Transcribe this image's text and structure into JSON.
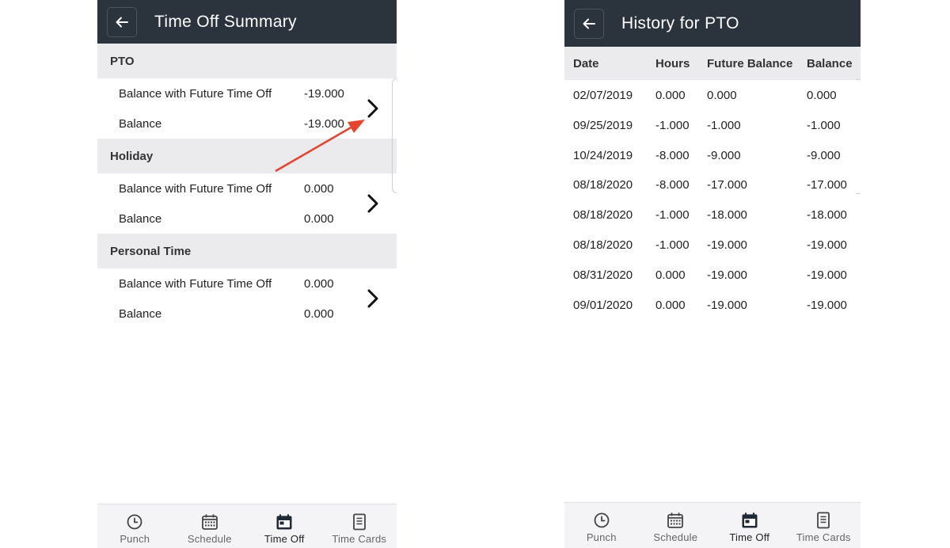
{
  "summary": {
    "title": "Time Off Summary",
    "sections": [
      {
        "name": "PTO",
        "rows": [
          {
            "label": "Balance with Future Time Off",
            "value": "-19.000"
          },
          {
            "label": "Balance",
            "value": "-19.000"
          }
        ]
      },
      {
        "name": "Holiday",
        "rows": [
          {
            "label": "Balance with Future Time Off",
            "value": "0.000"
          },
          {
            "label": "Balance",
            "value": "0.000"
          }
        ]
      },
      {
        "name": "Personal Time",
        "rows": [
          {
            "label": "Balance with Future Time Off",
            "value": "0.000"
          },
          {
            "label": "Balance",
            "value": "0.000"
          }
        ]
      }
    ]
  },
  "history": {
    "title": "History for PTO",
    "columns": [
      "Date",
      "Hours",
      "Future Balance",
      "Balance"
    ],
    "rows": [
      [
        "02/07/2019",
        "0.000",
        "0.000",
        "0.000"
      ],
      [
        "09/25/2019",
        "-1.000",
        "-1.000",
        "-1.000"
      ],
      [
        "10/24/2019",
        "-8.000",
        "-9.000",
        "-9.000"
      ],
      [
        "08/18/2020",
        "-8.000",
        "-17.000",
        "-17.000"
      ],
      [
        "08/18/2020",
        "-1.000",
        "-18.000",
        "-18.000"
      ],
      [
        "08/18/2020",
        "-1.000",
        "-19.000",
        "-19.000"
      ],
      [
        "08/31/2020",
        "0.000",
        "-19.000",
        "-19.000"
      ],
      [
        "09/01/2020",
        "0.000",
        "-19.000",
        "-19.000"
      ]
    ]
  },
  "nav": {
    "items": [
      {
        "label": "Punch",
        "icon": "clock-icon"
      },
      {
        "label": "Schedule",
        "icon": "calendar-grid-icon"
      },
      {
        "label": "Time Off",
        "icon": "calendar-filled-icon",
        "active": true
      },
      {
        "label": "Time Cards",
        "icon": "document-icon"
      }
    ]
  },
  "colors": {
    "appbar": "#2b333d",
    "section_bg": "#ebebee",
    "annotation_arrow": "#e8432e"
  }
}
